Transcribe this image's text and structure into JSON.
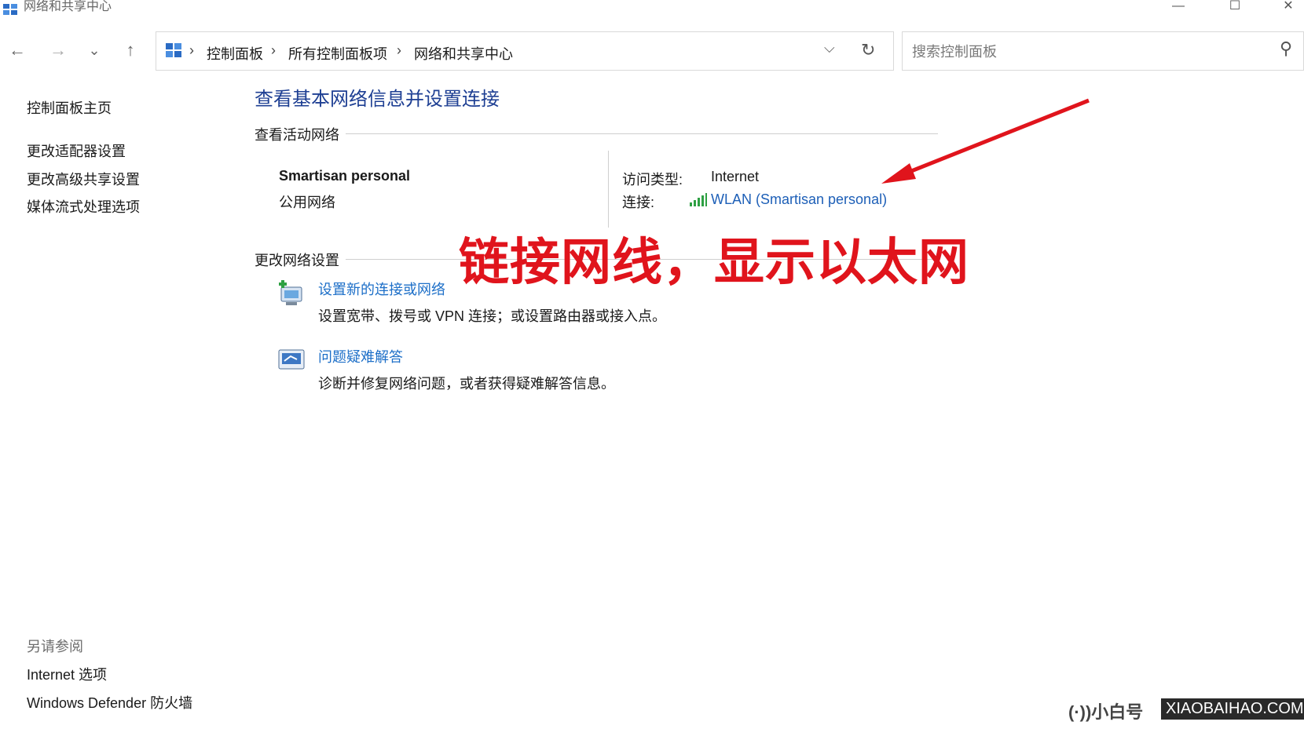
{
  "window": {
    "title": "网络和共享中心",
    "controls": {
      "minimize": "—",
      "maximize": "☐",
      "close": "✕"
    }
  },
  "nav": {
    "back": "←",
    "forward": "→",
    "recent": "⌄",
    "up": "↑"
  },
  "address": {
    "crumbs": [
      "控制面板",
      "所有控制面板项",
      "网络和共享中心"
    ],
    "separator": "›",
    "dropdown": "⌵",
    "refresh": "↻"
  },
  "search": {
    "placeholder": "搜索控制面板",
    "icon": "⚲"
  },
  "sidebar": {
    "links": [
      "控制面板主页",
      "更改适配器设置",
      "更改高级共享设置",
      "媒体流式处理选项"
    ],
    "see_also_title": "另请参阅",
    "see_also": [
      "Internet 选项",
      "Windows Defender 防火墙"
    ]
  },
  "main": {
    "heading": "查看基本网络信息并设置连接",
    "active_section": "查看活动网络",
    "network": {
      "name": "Smartisan personal",
      "type": "公用网络",
      "access_label": "访问类型:",
      "access_value": "Internet",
      "connection_label": "连接:",
      "connection_value": "WLAN (Smartisan personal)"
    },
    "change_section": "更改网络设置",
    "tasks": [
      {
        "link": "设置新的连接或网络",
        "desc": "设置宽带、拨号或 VPN 连接；或设置路由器或接入点。"
      },
      {
        "link": "问题疑难解答",
        "desc": "诊断并修复网络问题，或者获得疑难解答信息。"
      }
    ]
  },
  "annotation": {
    "text": "链接网线，显示以太网",
    "color": "#e0141c"
  },
  "watermark": {
    "brand": "(·))小白号",
    "domain": "XIAOBAIHAO.COM"
  },
  "colors": {
    "link": "#1d6fc8",
    "heading": "#1e3f93"
  }
}
